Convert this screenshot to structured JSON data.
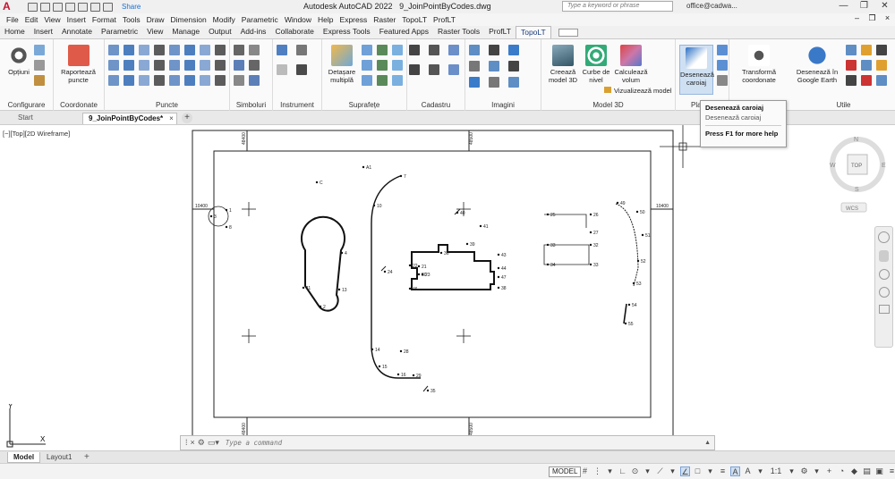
{
  "titlebar": {
    "app_name": "Autodesk AutoCAD 2022",
    "file_name": "9_JoinPointByCodes.dwg",
    "share_label": "Share",
    "search_placeholder": "Type a keyword or phrase",
    "user": "office@cadwa..."
  },
  "menu": [
    "File",
    "Edit",
    "View",
    "Insert",
    "Format",
    "Tools",
    "Draw",
    "Dimension",
    "Modify",
    "Parametric",
    "Window",
    "Help",
    "Express",
    "Raster",
    "TopoLT",
    "ProfLT"
  ],
  "ribbon_tabs": [
    "Home",
    "Insert",
    "Annotate",
    "Parametric",
    "View",
    "Manage",
    "Output",
    "Add-ins",
    "Collaborate",
    "Express Tools",
    "Featured Apps",
    "Raster Tools",
    "ProfLT",
    "TopoLT"
  ],
  "active_ribbon_tab": "TopoLT",
  "panels": {
    "configurare": {
      "label": "Configurare",
      "btn": "Opțiuni"
    },
    "coordonate": {
      "label": "Coordonate",
      "btn_line1": "Raportează",
      "btn_line2": "puncte"
    },
    "puncte": {
      "label": "Puncte"
    },
    "simboluri": {
      "label": "Simboluri"
    },
    "instrument": {
      "label": "Instrument"
    },
    "suprafete": {
      "label": "Suprafețe",
      "btn_line1": "Detașare",
      "btn_line2": "multiplă"
    },
    "cadastru": {
      "label": "Cadastru"
    },
    "imagini": {
      "label": "Imagini"
    },
    "model3d": {
      "label": "Model 3D",
      "b1_line1": "Creează",
      "b1_line2": "model 3D",
      "b2_line1": "Curbe de",
      "b2_line2": "nivel",
      "b3_line1": "Calculează",
      "b3_line2": "volum",
      "viz": "Vizualizează model"
    },
    "planse": {
      "label": "Pla",
      "btn_line1": "Desenează",
      "btn_line2": "caroiaj"
    },
    "transforma": {
      "btn_line1": "Transformă",
      "btn_line2": "coordonate"
    },
    "utile": {
      "label": "Utile",
      "btn_line1": "Desenează în",
      "btn_line2": "Google Earth"
    }
  },
  "tooltip": {
    "title": "Desenează caroiaj",
    "desc": "Desenează caroiaj",
    "help": "Press F1 for more help"
  },
  "doc_tabs": {
    "start": "Start",
    "active": "9_JoinPointByCodes*"
  },
  "viewport_label": "[−][Top][2D Wireframe]",
  "drawing": {
    "grid_labels": [
      "10400",
      "10400",
      "48400",
      "48500",
      "48400",
      "48500"
    ],
    "point_labels": [
      "A1",
      "7",
      "3",
      "1",
      "8",
      "10",
      "C",
      "4",
      "11",
      "13",
      "2",
      "40",
      "41",
      "39",
      "43",
      "44",
      "47",
      "38",
      "36",
      "21",
      "23",
      "22",
      "30",
      "46",
      "24",
      "25",
      "26",
      "27",
      "33",
      "32",
      "34",
      "33",
      "49",
      "50",
      "51",
      "52",
      "53",
      "54",
      "55",
      "14",
      "15",
      "16",
      "28",
      "29",
      "35"
    ],
    "viewcube": {
      "top": "TOP",
      "n": "N",
      "s": "S",
      "e": "E",
      "w": "W",
      "wcs": "WCS"
    }
  },
  "cmd": {
    "placeholder": "Type a command"
  },
  "layout_tabs": [
    "Model",
    "Layout1"
  ],
  "status": {
    "model": "MODEL",
    "scale": "1:1"
  }
}
